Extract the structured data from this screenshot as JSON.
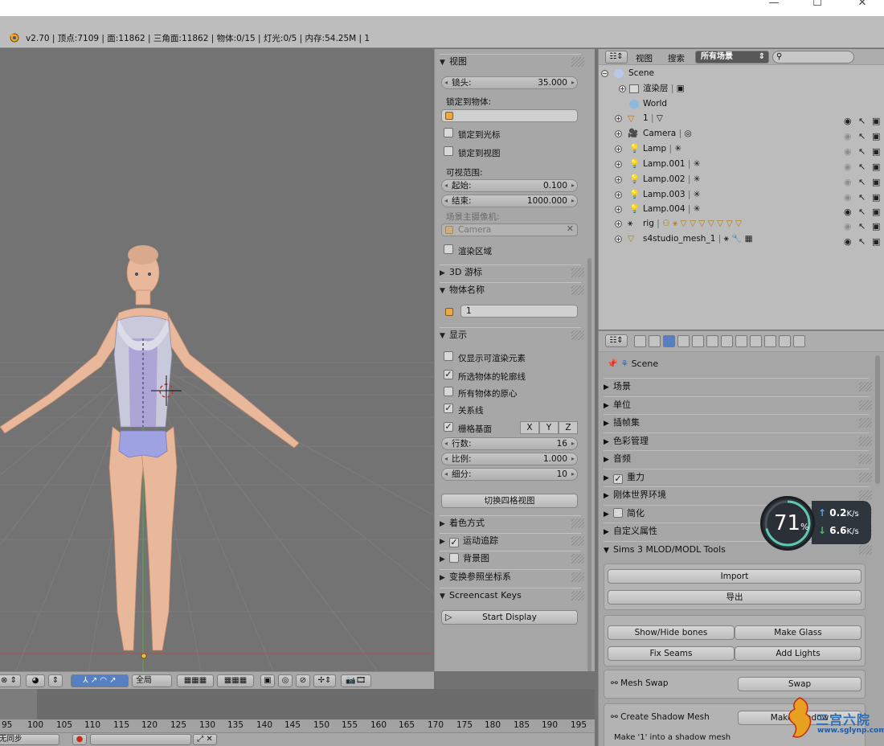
{
  "window": {
    "minimize_glyph": "—",
    "maximize_glyph": "☐",
    "close_glyph": "✕"
  },
  "info_bar": {
    "stats": "v2.70 | 顶点:7109 | 面:11862 | 三角面:11862 | 物体:0/15 | 灯光:0/5 | 内存:54.25M | 1"
  },
  "npanel": {
    "view_section": "视图",
    "lens_label": "镜头:",
    "lens_value": "35.000",
    "lock_to_object_label": "锁定到物体:",
    "lock_to_cursor": "锁定到光标",
    "lock_to_view": "锁定到视图",
    "clip_label": "可视范围:",
    "clip_start_label": "起始:",
    "clip_start_value": "0.100",
    "clip_end_label": "结束:",
    "clip_end_value": "1000.000",
    "scene_camera_label": "场景主摄像机:",
    "scene_camera_value": "Camera",
    "render_border": "渲染区域",
    "cursor_section": "3D 游标",
    "item_section": "物体名称",
    "item_name": "1",
    "display_section": "显示",
    "only_render": "仅显示可渲染元素",
    "outline_selected": "所选物体的轮廓线",
    "all_origins": "所有物体的原心",
    "relationship_lines": "关系线",
    "grid_floor": "栅格基面",
    "axis_x": "X",
    "axis_y": "Y",
    "axis_z": "Z",
    "lines_label": "行数:",
    "lines_value": "16",
    "scale_label": "比例:",
    "scale_value": "1.000",
    "subdiv_label": "细分:",
    "subdiv_value": "10",
    "toggle_quad": "切换四格视图",
    "shading_section": "着色方式",
    "motion_tracking_section": "运动追踪",
    "background_section": "背景图",
    "transform_orientation_section": "变换参照坐标系",
    "screencast_section": "Screencast Keys",
    "start_display": "Start Display"
  },
  "viewport_header": {
    "pivot_label": "全局"
  },
  "timeline": {
    "ticks": [
      "95",
      "100",
      "105",
      "110",
      "115",
      "120",
      "125",
      "130",
      "135",
      "140",
      "145",
      "150",
      "155",
      "160",
      "165",
      "170",
      "175",
      "180",
      "185",
      "190",
      "195"
    ],
    "bottom_left": "无同步"
  },
  "outliner": {
    "view_menu": "视图",
    "search_menu": "搜索",
    "scene_filter": "所有场景",
    "rows": [
      {
        "name": "Scene"
      },
      {
        "name": "渲染层"
      },
      {
        "name": "World"
      },
      {
        "name": "1"
      },
      {
        "name": "Camera"
      },
      {
        "name": "Lamp"
      },
      {
        "name": "Lamp.001"
      },
      {
        "name": "Lamp.002"
      },
      {
        "name": "Lamp.003"
      },
      {
        "name": "Lamp.004"
      },
      {
        "name": "rig"
      },
      {
        "name": "s4studio_mesh_1"
      }
    ]
  },
  "properties": {
    "context": "Scene",
    "sections": [
      "场景",
      "单位",
      "插帧集",
      "色彩管理",
      "音频",
      "重力",
      "刚体世界环境",
      "简化",
      "自定义属性"
    ],
    "sims_section": "Sims 3 MLOD/MODL Tools",
    "import_btn": "Import",
    "export_btn": "导出",
    "show_hide_bones": "Show/Hide bones",
    "make_glass": "Make Glass",
    "fix_seams": "Fix Seams",
    "add_lights": "Add Lights",
    "mesh_swap_label": "Mesh Swap",
    "swap_btn": "Swap",
    "create_shadow_label": "Create Shadow Mesh",
    "make_shadow_btn": "Make Shadow",
    "shadow_hint": "Make '1' into a shadow mesh"
  },
  "net_widget": {
    "percent": "71",
    "percent_sign": "%",
    "up": "0.2",
    "up_unit": "K/s",
    "down": "6.6",
    "down_unit": "K/s"
  },
  "watermark": {
    "text": "三宫六院",
    "url": "www.sglynp.com"
  },
  "colors": {
    "accent": "#5680c2",
    "viewport": "#737373",
    "panel": "#a7a7a7",
    "widget_bg": "#2b3036"
  }
}
